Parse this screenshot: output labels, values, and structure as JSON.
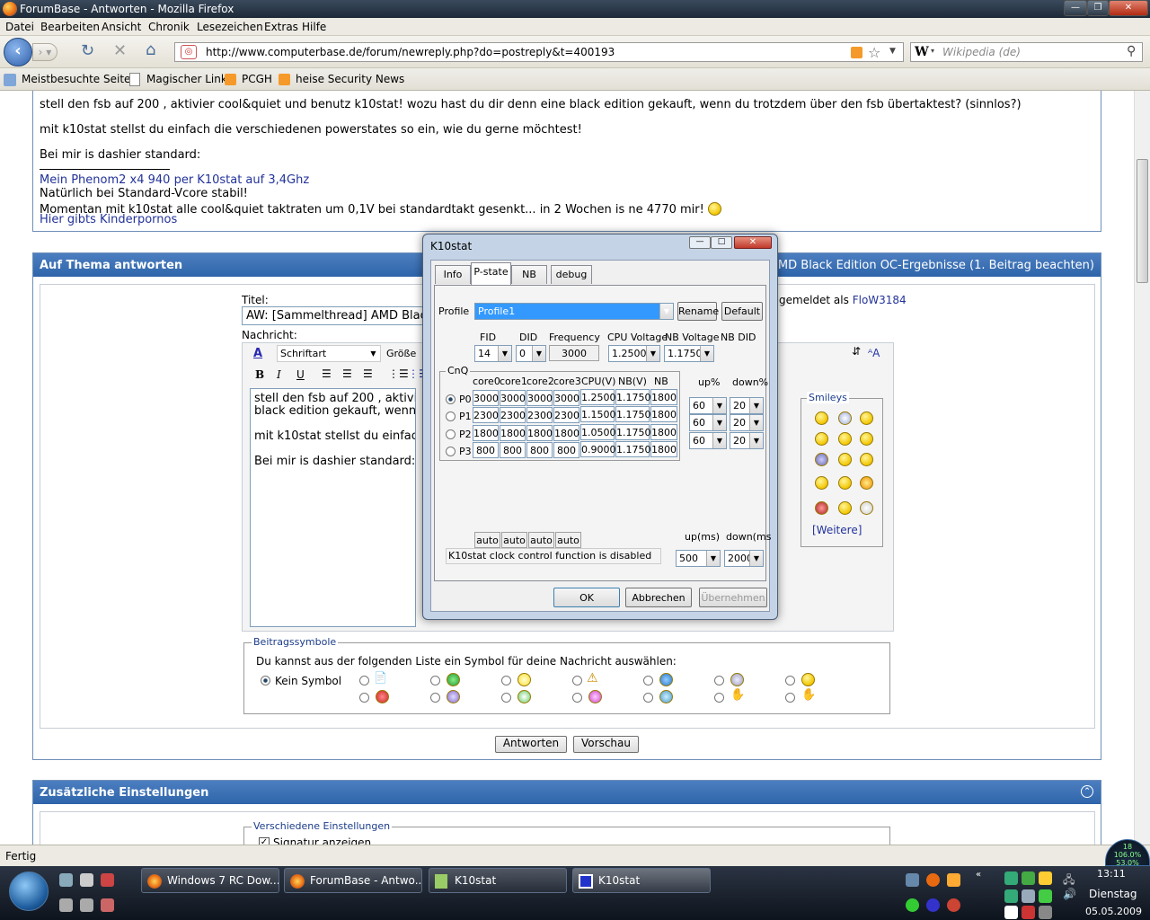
{
  "browser": {
    "title": "ForumBase - Antworten - Mozilla Firefox",
    "menu": [
      "Datei",
      "Bearbeiten",
      "Ansicht",
      "Chronik",
      "Lesezeichen",
      "Extras",
      "Hilfe"
    ],
    "url": "http://www.computerbase.de/forum/newreply.php?do=postreply&t=400193",
    "search_placeholder": "Wikipedia (de)",
    "bookmarks": [
      "Meistbesuchte Seiten",
      "Magischer Link",
      "PCGH",
      "heise Security News"
    ],
    "status": "Fertig"
  },
  "quote": {
    "line1": "stell den fsb auf 200 , aktivier cool&quiet und benutz k10stat! wozu hast du dir denn eine black edition gekauft, wenn du trotzdem über den fsb übertaktest? (sinnlos?)",
    "line2": "mit k10stat stellst du einfach die verschiedenen powerstates so ein, wie du gerne möchtest!",
    "line3": "Bei mir is dashier standard:",
    "sig_link": "Mein Phenom2 x4 940 per K10stat auf 3,4Ghz",
    "sig_line2": "Natürlich bei Standard-Vcore stabil!",
    "sig_line3": "Momentan mit k10stat alle cool&quiet taktraten um 0,1V bei standardtakt gesenkt... in 2 Wochen is ne 4770 mir!",
    "sig_link2": "Hier gibts Kinderpornos"
  },
  "reply": {
    "header": "Auf Thema antworten",
    "header_right": "read] AMD Black Edition OC-Ergebnisse (1. Beitrag beachten)",
    "title_label": "Titel:",
    "title_value": "AW: [Sammelthread] AMD Black",
    "logged_in": "gemeldet als",
    "user": "FloW3184",
    "message_label": "Nachricht:",
    "font_select": "Schriftart",
    "size_select": "Größe",
    "editor_lines": [
      "stell den fsb auf 200 , aktivier",
      "black edition gekauft, wenn du",
      "",
      "mit k10stat stellst du einfach d",
      "",
      "Bei mir is dashier standard:"
    ],
    "smileys_label": "Smileys",
    "more_link": "[Weitere]",
    "symbols_label": "Beitragssymbole",
    "symbols_hint": "Du kannst aus der folgenden Liste ein Symbol für deine Nachricht auswählen:",
    "no_symbol": "Kein Symbol",
    "submit": "Antworten",
    "preview": "Vorschau"
  },
  "extra": {
    "header": "Zusätzliche Einstellungen",
    "misc_label": "Verschiedene Einstellungen",
    "signature": "Signatur anzeigen"
  },
  "k10stat": {
    "title": "K10stat",
    "tabs": [
      "Info",
      "P-state",
      "NB",
      "debug"
    ],
    "profile_label": "Profile",
    "profile_value": "Profile1",
    "rename": "Rename",
    "default": "Default",
    "fid_label": "FID",
    "did_label": "DID",
    "freq_label": "Frequency",
    "cpuv_label": "CPU Voltage",
    "nbv_label": "NB Voltage",
    "nbdid_label": "NB DID",
    "fid": "14",
    "did": "0",
    "freq": "3000",
    "cpuv": "1.2500",
    "nbv": "1.1750",
    "cnq_label": "CnQ",
    "columns": [
      "core0",
      "core1",
      "core2",
      "core3",
      "CPU(V)",
      "NB(V)",
      "NB"
    ],
    "rows": [
      {
        "p": "P0",
        "c": [
          "3000",
          "3000",
          "3000",
          "3000"
        ],
        "cpu": "1.2500",
        "nbv": "1.1750",
        "nb": "1800"
      },
      {
        "p": "P1",
        "c": [
          "2300",
          "2300",
          "2300",
          "2300"
        ],
        "cpu": "1.1500",
        "nbv": "1.1750",
        "nb": "1800"
      },
      {
        "p": "P2",
        "c": [
          "1800",
          "1800",
          "1800",
          "1800"
        ],
        "cpu": "1.0500",
        "nbv": "1.1750",
        "nb": "1800"
      },
      {
        "p": "P3",
        "c": [
          "800",
          "800",
          "800",
          "800"
        ],
        "cpu": "0.9000",
        "nbv": "1.1750",
        "nb": "1800"
      }
    ],
    "up_label": "up%",
    "down_label": "down%",
    "up": [
      "60",
      "60",
      "60"
    ],
    "down": [
      "20",
      "20",
      "20"
    ],
    "auto": [
      "auto",
      "auto",
      "auto",
      "auto"
    ],
    "status": "K10stat clock control function is disabled",
    "upms_label": "up(ms)",
    "downms_label": "down(ms",
    "upms": "500",
    "downms": "2000",
    "ok": "OK",
    "cancel": "Abbrechen",
    "apply": "Übernehmen"
  },
  "taskbar": {
    "tasks": [
      "Windows 7 RC Dow...",
      "ForumBase - Antwo...",
      "K10stat",
      "K10stat"
    ],
    "time": "13:11",
    "day": "Dienstag",
    "date": "05.05.2009",
    "gauge_top": "18",
    "gauge_mid": "106.0%",
    "gauge_bot": "53.0%"
  },
  "colors": {
    "accent": "#2e64aa",
    "link": "#22329a"
  }
}
